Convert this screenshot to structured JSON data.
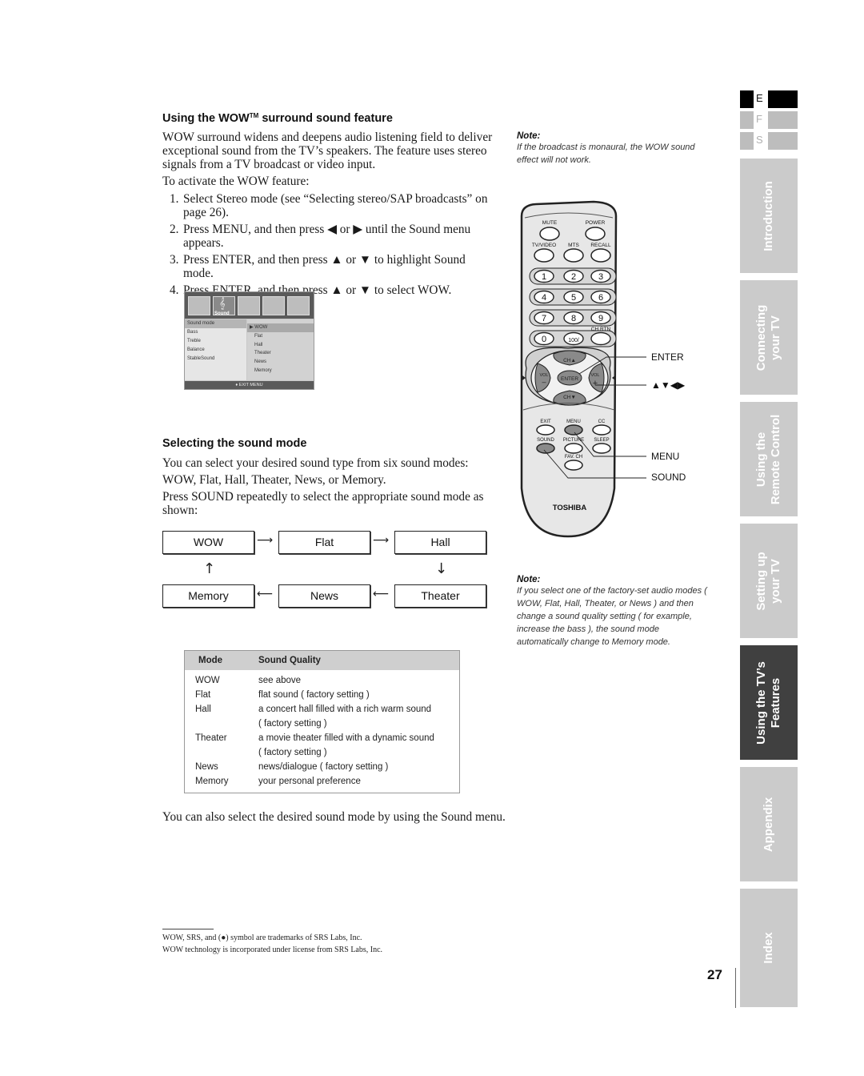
{
  "section1": {
    "heading": "Using the WOW",
    "heading_tm": "TM",
    "heading_rest": " surround sound feature",
    "intro_lines": [
      "WOW surround widens and deepens audio listening field to deliver",
      "exceptional sound from the TV’s speakers. The feature uses stereo",
      "signals from a TV broadcast or video input."
    ],
    "activate_label": "To activate the WOW feature:",
    "steps": [
      {
        "num": "1.",
        "text": "Select Stereo mode (see “Selecting stereo/SAP broadcasts” on page 26)."
      },
      {
        "num": "2.",
        "text": "Press MENU, and then press ◀ or ▶ until the Sound menu appears."
      },
      {
        "num": "3.",
        "text": "Press ENTER, and then press ▲ or ▼ to highlight Sound mode."
      },
      {
        "num": "4.",
        "text": "Press ENTER, and then press ▲ or ▼ to select WOW."
      }
    ]
  },
  "osd_menu": {
    "active_tab": "Sound",
    "left_items": [
      "Sound mode",
      "Bass",
      "Treble",
      "Balance",
      "StableSound"
    ],
    "right_items": [
      "WOW",
      "Flat",
      "Hall",
      "Theater",
      "News",
      "Memory"
    ],
    "selected_left": "Sound mode",
    "selected_right": "WOW",
    "pointer": "▶",
    "footer": "♦ EXIT MENU"
  },
  "section2": {
    "heading": "Selecting the sound mode",
    "para1_lines": [
      "You can select your desired sound type from six sound modes:",
      "WOW, Flat, Hall, Theater, News, or Memory."
    ],
    "para2": "Press SOUND repeatedly to select the appropriate sound mode as shown:",
    "flow": {
      "top": [
        "WOW",
        "Flat",
        "Hall"
      ],
      "bottom": [
        "Memory",
        "News",
        "Theater"
      ],
      "arrow_right": "⟶",
      "arrow_left": "⟵",
      "arrow_up": "↑",
      "arrow_down": "↓"
    }
  },
  "quality_table": {
    "headers": [
      "Mode",
      "Sound Quality"
    ],
    "rows": [
      {
        "mode": "WOW",
        "quality": [
          "see above"
        ]
      },
      {
        "mode": "Flat",
        "quality": [
          "flat sound ( factory setting )"
        ]
      },
      {
        "mode": "Hall",
        "quality": [
          "a concert hall filled with a rich warm sound",
          "( factory setting )"
        ]
      },
      {
        "mode": "Theater",
        "quality": [
          "a movie theater filled with a dynamic sound",
          "( factory setting )"
        ]
      },
      {
        "mode": "News",
        "quality": [
          "news/dialogue ( factory setting )"
        ]
      },
      {
        "mode": "Memory",
        "quality": [
          "your personal preference"
        ]
      }
    ]
  },
  "closing_text": "You can also select the desired sound mode by using the Sound menu.",
  "notes": [
    {
      "title": "Note:",
      "text": "If the broadcast is monaural, the WOW sound effect will not work."
    },
    {
      "title": "Note:",
      "text": "If you select one of the factory-set audio modes ( WOW, Flat, Hall, Theater, or News ) and then change a sound quality setting ( for example, increase the bass ), the sound mode automatically change to Memory mode."
    }
  ],
  "remote": {
    "brand": "TOSHIBA",
    "buttons_top": [
      "MUTE",
      "POWER"
    ],
    "buttons_row2": [
      "TV/VIDEO",
      "MTS",
      "RECALL"
    ],
    "digits": [
      "1",
      "2",
      "3",
      "4",
      "5",
      "6",
      "7",
      "8",
      "9",
      "0",
      "100/"
    ],
    "ch_rtn": "CH RTN",
    "dpad": {
      "up": "CH▲",
      "down": "CH▼",
      "center": "ENTER",
      "left": "VOL",
      "left_sign": "–",
      "right": "VOL",
      "right_sign": "+"
    },
    "func_row1": [
      "EXIT",
      "MENU",
      "CC"
    ],
    "func_row2": [
      "SOUND",
      "PICTURE",
      "SLEEP"
    ],
    "func_row3": [
      "FAV. CH"
    ],
    "callouts": [
      "ENTER",
      "▲▼◀▶",
      "MENU",
      "SOUND"
    ]
  },
  "languages": [
    {
      "letter": "E",
      "active": true
    },
    {
      "letter": "F",
      "active": false
    },
    {
      "letter": "S",
      "active": false
    }
  ],
  "side_tabs": [
    {
      "line1": "Introduction",
      "line2": "",
      "active": false
    },
    {
      "line1": "Connecting",
      "line2": "your TV",
      "active": false
    },
    {
      "line1": "Using the",
      "line2": "Remote Control",
      "active": false
    },
    {
      "line1": "Setting up",
      "line2": "your TV",
      "active": false
    },
    {
      "line1": "Using the TV’s",
      "line2": "Features",
      "active": true
    },
    {
      "line1": "Appendix",
      "line2": "",
      "active": false
    },
    {
      "line1": "Index",
      "line2": "",
      "active": false
    }
  ],
  "footnotes": [
    "WOW, SRS, and (●) symbol are trademarks of SRS Labs, Inc.",
    "WOW technology is incorporated under license from SRS Labs, Inc."
  ],
  "page_number": "27",
  "colors": {
    "active_tab": "#404040",
    "inactive_tab": "#cbcbcb",
    "table_header": "#cfcfcf",
    "highlight_button": "#8a8a8a"
  }
}
